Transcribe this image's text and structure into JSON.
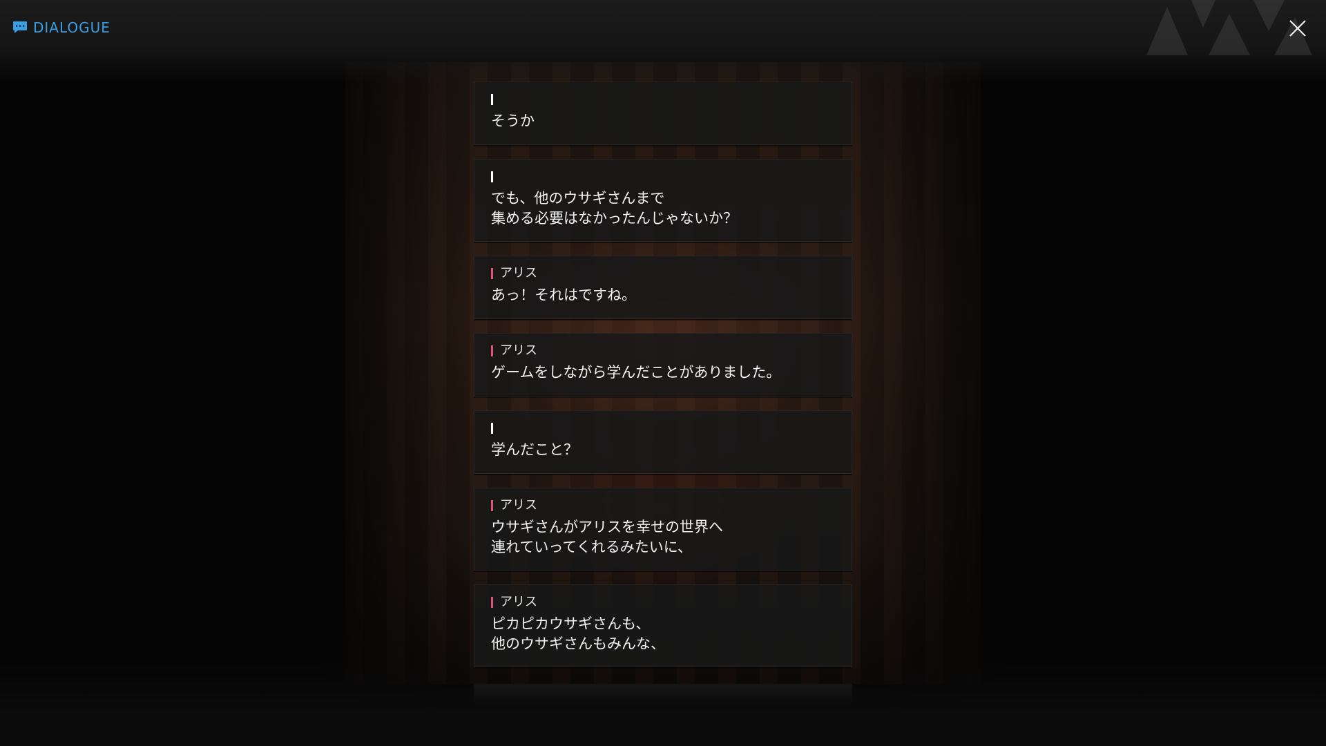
{
  "header": {
    "title": "DIALOGUE",
    "title_icon": "chat-bubble-icon",
    "close_icon": "close-icon",
    "accent_color": "#3aa0e6"
  },
  "speaker_colors": {
    "player": "#ffffff",
    "alice": "#e2507a"
  },
  "dialogue": [
    {
      "speaker": "",
      "speaker_type": "player",
      "text": "そうか"
    },
    {
      "speaker": "",
      "speaker_type": "player",
      "text": "でも、他のウサギさんまで\n集める必要はなかったんじゃないか？"
    },
    {
      "speaker": "アリス",
      "speaker_type": "alice",
      "text": "あっ！それはですね。"
    },
    {
      "speaker": "アリス",
      "speaker_type": "alice",
      "text": "ゲームをしながら学んだことがありました。"
    },
    {
      "speaker": "",
      "speaker_type": "player",
      "text": "学んだこと？"
    },
    {
      "speaker": "アリス",
      "speaker_type": "alice",
      "text": "ウサギさんがアリスを幸せの世界へ\n連れていってくれるみたいに、"
    },
    {
      "speaker": "アリス",
      "speaker_type": "alice",
      "text": "ピカピカウサギさんも、\n他のウサギさんもみんな、"
    }
  ]
}
